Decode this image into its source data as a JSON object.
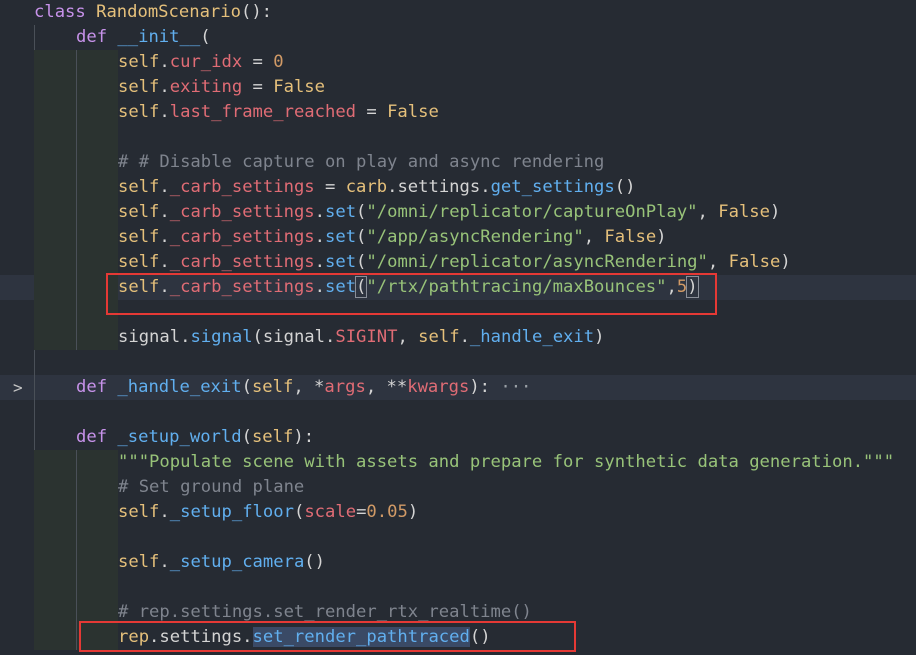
{
  "editor": {
    "lines": [
      {
        "indent": 0,
        "tokens": [
          {
            "t": "class ",
            "c": "kw"
          },
          {
            "t": "RandomScenario",
            "c": "cls"
          },
          {
            "t": "():",
            "c": "op"
          }
        ]
      },
      {
        "indent": 1,
        "tokens": [
          {
            "t": "def ",
            "c": "kw"
          },
          {
            "t": "__init__",
            "c": "fn"
          },
          {
            "t": "(",
            "c": "op"
          }
        ]
      },
      {
        "indent": 2,
        "tokens": [
          {
            "t": "self",
            "c": "self"
          },
          {
            "t": ".",
            "c": "op"
          },
          {
            "t": "cur_idx",
            "c": "attr"
          },
          {
            "t": " = ",
            "c": "op"
          },
          {
            "t": "0",
            "c": "num"
          }
        ]
      },
      {
        "indent": 2,
        "tokens": [
          {
            "t": "self",
            "c": "self"
          },
          {
            "t": ".",
            "c": "op"
          },
          {
            "t": "exiting",
            "c": "attr"
          },
          {
            "t": " = ",
            "c": "op"
          },
          {
            "t": "False",
            "c": "bool"
          }
        ]
      },
      {
        "indent": 2,
        "tokens": [
          {
            "t": "self",
            "c": "self"
          },
          {
            "t": ".",
            "c": "op"
          },
          {
            "t": "last_frame_reached",
            "c": "attr"
          },
          {
            "t": " = ",
            "c": "op"
          },
          {
            "t": "False",
            "c": "bool"
          }
        ]
      },
      {
        "indent": 2,
        "tokens": []
      },
      {
        "indent": 2,
        "tokens": [
          {
            "t": "# # Disable capture on play and async rendering",
            "c": "cmt"
          }
        ]
      },
      {
        "indent": 2,
        "tokens": [
          {
            "t": "self",
            "c": "self"
          },
          {
            "t": ".",
            "c": "op"
          },
          {
            "t": "_carb_settings",
            "c": "attr"
          },
          {
            "t": " = ",
            "c": "op"
          },
          {
            "t": "carb",
            "c": "self"
          },
          {
            "t": ".settings.",
            "c": "op"
          },
          {
            "t": "get_settings",
            "c": "fn"
          },
          {
            "t": "()",
            "c": "op"
          }
        ]
      },
      {
        "indent": 2,
        "tokens": [
          {
            "t": "self",
            "c": "self"
          },
          {
            "t": ".",
            "c": "op"
          },
          {
            "t": "_carb_settings",
            "c": "attr"
          },
          {
            "t": ".",
            "c": "op"
          },
          {
            "t": "set",
            "c": "fn"
          },
          {
            "t": "(",
            "c": "op"
          },
          {
            "t": "\"/omni/replicator/captureOnPlay\"",
            "c": "str"
          },
          {
            "t": ", ",
            "c": "op"
          },
          {
            "t": "False",
            "c": "bool"
          },
          {
            "t": ")",
            "c": "op"
          }
        ]
      },
      {
        "indent": 2,
        "tokens": [
          {
            "t": "self",
            "c": "self"
          },
          {
            "t": ".",
            "c": "op"
          },
          {
            "t": "_carb_settings",
            "c": "attr"
          },
          {
            "t": ".",
            "c": "op"
          },
          {
            "t": "set",
            "c": "fn"
          },
          {
            "t": "(",
            "c": "op"
          },
          {
            "t": "\"/app/asyncRendering\"",
            "c": "str"
          },
          {
            "t": ", ",
            "c": "op"
          },
          {
            "t": "False",
            "c": "bool"
          },
          {
            "t": ")",
            "c": "op"
          }
        ]
      },
      {
        "indent": 2,
        "tokens": [
          {
            "t": "self",
            "c": "self"
          },
          {
            "t": ".",
            "c": "op"
          },
          {
            "t": "_carb_settings",
            "c": "attr"
          },
          {
            "t": ".",
            "c": "op"
          },
          {
            "t": "set",
            "c": "fn"
          },
          {
            "t": "(",
            "c": "op"
          },
          {
            "t": "\"/omni/replicator/asyncRendering\"",
            "c": "str"
          },
          {
            "t": ", ",
            "c": "op"
          },
          {
            "t": "False",
            "c": "bool"
          },
          {
            "t": ")",
            "c": "op"
          }
        ]
      },
      {
        "indent": 2,
        "highlight": true,
        "tokens": [
          {
            "t": "self",
            "c": "self"
          },
          {
            "t": ".",
            "c": "op"
          },
          {
            "t": "_carb_settings",
            "c": "attr"
          },
          {
            "t": ".",
            "c": "op"
          },
          {
            "t": "set",
            "c": "fn"
          },
          {
            "t": "(",
            "c": "paren-match"
          },
          {
            "t": "\"/rtx/pathtracing/maxBounces\"",
            "c": "str"
          },
          {
            "t": ",",
            "c": "op"
          },
          {
            "t": "5",
            "c": "num"
          },
          {
            "t": ")",
            "c": "paren-match"
          }
        ]
      },
      {
        "indent": 2,
        "tokens": []
      },
      {
        "indent": 2,
        "tokens": [
          {
            "t": "signal",
            "c": "plain"
          },
          {
            "t": ".",
            "c": "op"
          },
          {
            "t": "signal",
            "c": "fn"
          },
          {
            "t": "(",
            "c": "op"
          },
          {
            "t": "signal",
            "c": "plain"
          },
          {
            "t": ".",
            "c": "op"
          },
          {
            "t": "SIGINT",
            "c": "attr"
          },
          {
            "t": ", ",
            "c": "op"
          },
          {
            "t": "self",
            "c": "self"
          },
          {
            "t": ".",
            "c": "op"
          },
          {
            "t": "_handle_exit",
            "c": "fn"
          },
          {
            "t": ")",
            "c": "op"
          }
        ]
      },
      {
        "indent": 1,
        "tokens": []
      },
      {
        "indent": 1,
        "folded": true,
        "highlight": true,
        "tokens": [
          {
            "t": "def ",
            "c": "kw"
          },
          {
            "t": "_handle_exit",
            "c": "fn"
          },
          {
            "t": "(",
            "c": "op"
          },
          {
            "t": "self",
            "c": "self"
          },
          {
            "t": ", *",
            "c": "op"
          },
          {
            "t": "args",
            "c": "param"
          },
          {
            "t": ", **",
            "c": "op"
          },
          {
            "t": "kwargs",
            "c": "param"
          },
          {
            "t": "):",
            "c": "op"
          },
          {
            "t": " ···",
            "c": "ellipsis"
          }
        ]
      },
      {
        "indent": 1,
        "tokens": []
      },
      {
        "indent": 1,
        "tokens": [
          {
            "t": "def ",
            "c": "kw"
          },
          {
            "t": "_setup_world",
            "c": "fn"
          },
          {
            "t": "(",
            "c": "op"
          },
          {
            "t": "self",
            "c": "self"
          },
          {
            "t": "):",
            "c": "op"
          }
        ]
      },
      {
        "indent": 2,
        "tokens": [
          {
            "t": "\"\"\"Populate scene with assets and prepare for synthetic data generation.\"\"\"",
            "c": "str"
          }
        ]
      },
      {
        "indent": 2,
        "tokens": [
          {
            "t": "# Set ground plane",
            "c": "cmt"
          }
        ]
      },
      {
        "indent": 2,
        "tokens": [
          {
            "t": "self",
            "c": "self"
          },
          {
            "t": ".",
            "c": "op"
          },
          {
            "t": "_setup_floor",
            "c": "fn"
          },
          {
            "t": "(",
            "c": "op"
          },
          {
            "t": "scale",
            "c": "param"
          },
          {
            "t": "=",
            "c": "op"
          },
          {
            "t": "0.05",
            "c": "num"
          },
          {
            "t": ")",
            "c": "op"
          }
        ]
      },
      {
        "indent": 2,
        "tokens": []
      },
      {
        "indent": 2,
        "tokens": [
          {
            "t": "self",
            "c": "self"
          },
          {
            "t": ".",
            "c": "op"
          },
          {
            "t": "_setup_camera",
            "c": "fn"
          },
          {
            "t": "()",
            "c": "op"
          }
        ]
      },
      {
        "indent": 2,
        "tokens": []
      },
      {
        "indent": 2,
        "tokens": [
          {
            "t": "# rep.settings.set_render_rtx_realtime()",
            "c": "cmt"
          }
        ]
      },
      {
        "indent": 2,
        "tokens": [
          {
            "t": "rep",
            "c": "self"
          },
          {
            "t": ".settings.",
            "c": "op"
          },
          {
            "t": "set_render_pathtraced",
            "c": "fn-sel"
          },
          {
            "t": "()",
            "c": "op"
          }
        ]
      }
    ]
  },
  "colors": {
    "background": "#262b33",
    "annotation": "#e53935"
  },
  "icons": {
    "fold": "chevron-right-icon"
  },
  "fold_glyph": ">"
}
